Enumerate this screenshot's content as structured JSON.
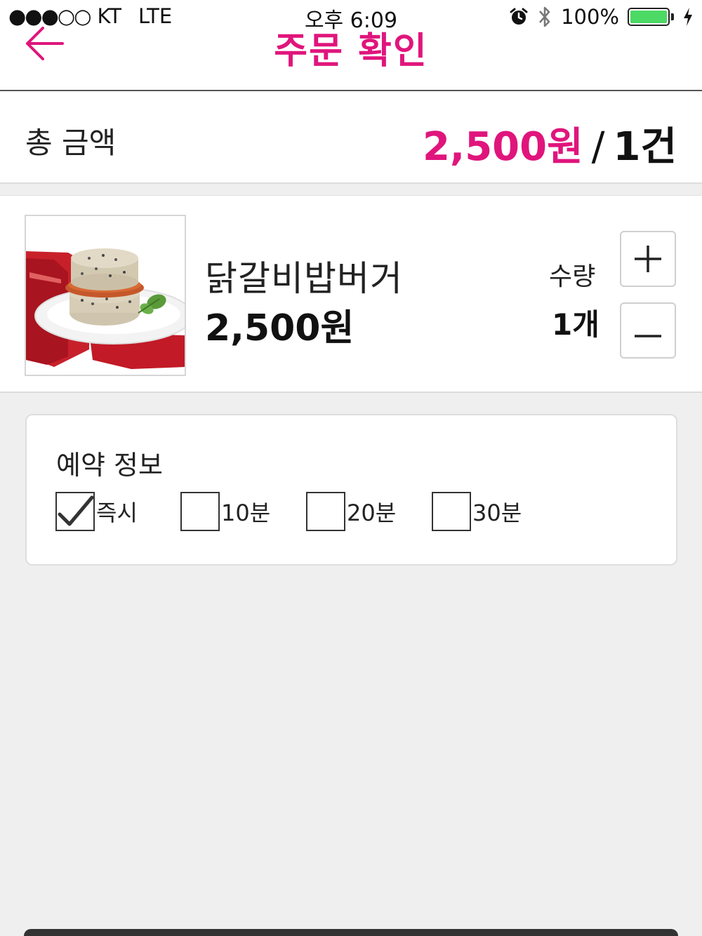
{
  "status_bar": {
    "signal": "●●●○○",
    "carrier": "KT",
    "network": "LTE",
    "time": "오후 6:09",
    "battery": "100%"
  },
  "header": {
    "title": "주문 확인"
  },
  "total": {
    "label": "총 금액",
    "price": "2,500원",
    "separator": "/",
    "count": "1건"
  },
  "product": {
    "name": "닭갈비밥버거",
    "price": "2,500원",
    "quantity_label": "수량",
    "quantity_value": "1개"
  },
  "reservation": {
    "title": "예약 정보",
    "options": [
      {
        "label": "즉시",
        "checked": true
      },
      {
        "label": "10분",
        "checked": false
      },
      {
        "label": "20분",
        "checked": false
      },
      {
        "label": "30분",
        "checked": false
      }
    ]
  },
  "colors": {
    "accent": "#e0157c",
    "background": "#efefef",
    "battery": "#4cd964"
  }
}
